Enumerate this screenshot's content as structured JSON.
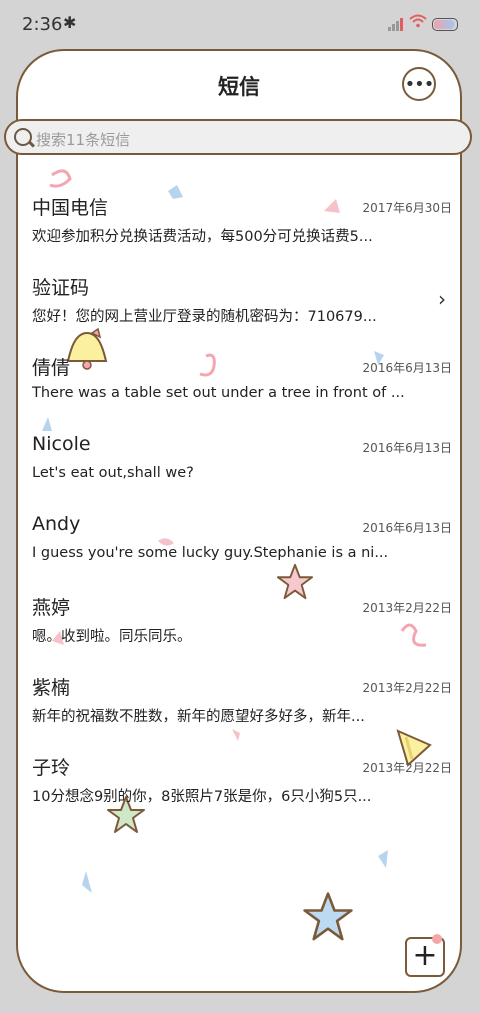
{
  "status": {
    "time": "2:36",
    "bluetooth_icon": "bluetooth-icon",
    "signal_icon": "signal-icon",
    "wifi_icon": "wifi-icon",
    "battery_icon": "battery-icon"
  },
  "header": {
    "title": "短信",
    "more_icon": "more-icon",
    "more_label": "•••"
  },
  "search": {
    "placeholder": "搜索11条短信",
    "icon": "search-icon"
  },
  "messages": [
    {
      "name": "中国电信",
      "date": "2017年6月30日",
      "preview": "欢迎参加积分兑换话费活动，每500分可兑换话费5..."
    },
    {
      "name": "验证码",
      "date": "",
      "preview": "您好！您的网上营业厅登录的随机密码为：710679...",
      "chevron": "›"
    },
    {
      "name": "倩倩",
      "date": "2016年6月13日",
      "preview": "There was a table set out under a tree in front of ..."
    },
    {
      "name": "Nicole",
      "date": "2016年6月13日",
      "preview": "Let's eat out,shall we?"
    },
    {
      "name": "Andy",
      "date": "2016年6月13日",
      "preview": "I guess you're some lucky guy.Stephanie is a ni..."
    },
    {
      "name": "燕婷",
      "date": "2013年2月22日",
      "preview": "嗯。收到啦。同乐同乐。"
    },
    {
      "name": "紫楠",
      "date": "2013年2月22日",
      "preview": "新年的祝福数不胜数，新年的愿望好多好多，新年..."
    },
    {
      "name": "子玲",
      "date": "2013年2月22日",
      "preview": "10分想念9别的你，8张照片7张是你，6只小狗5只..."
    }
  ],
  "fab": {
    "label": "+",
    "icon": "compose-icon"
  },
  "colors": {
    "accent": "#7b5a3a",
    "background": "#d4d4d4"
  }
}
